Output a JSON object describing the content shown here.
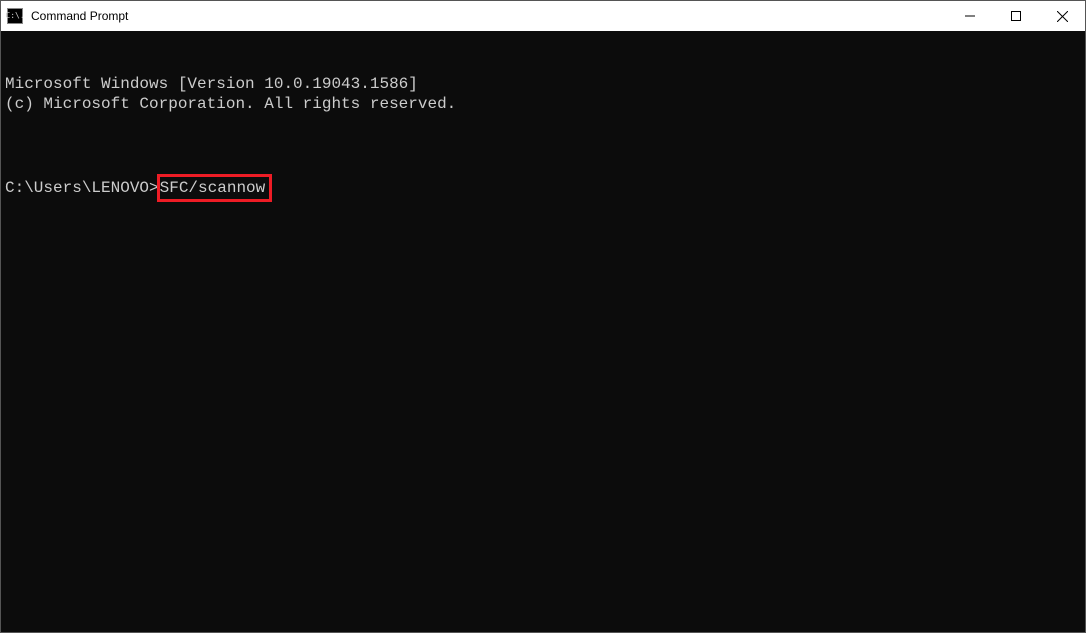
{
  "window": {
    "title": "Command Prompt",
    "app_icon_text": "C:\\."
  },
  "console": {
    "line1": "Microsoft Windows [Version 10.0.19043.1586]",
    "line2": "(c) Microsoft Corporation. All rights reserved.",
    "prompt": "C:\\Users\\LENOVO>",
    "command": "SFC/scannow"
  },
  "annotation": {
    "highlight_color": "#ee1c25"
  }
}
